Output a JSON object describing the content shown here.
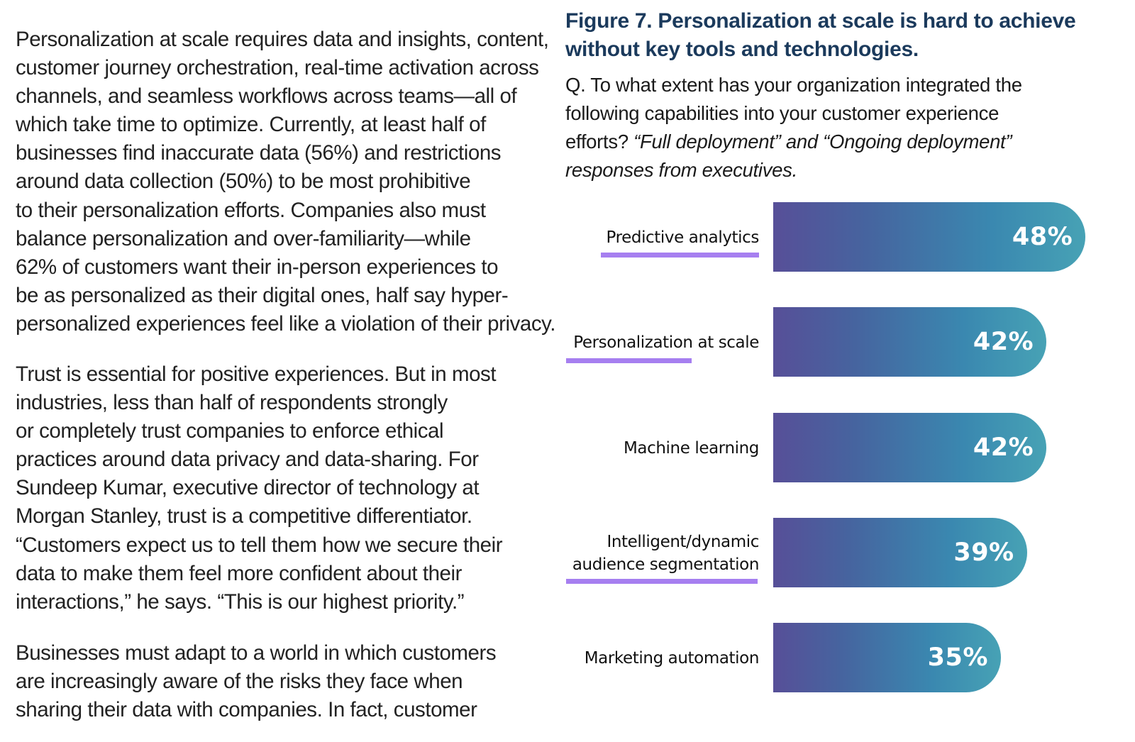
{
  "document": {
    "cut_off_top_line": "",
    "paragraphs": [
      {
        "lines": [
          "Personalization at scale requires data and insights, content,",
          "customer journey orchestration, real-time activation across",
          "channels, and seamless workflows across teams—all of",
          "which take time to optimize. Currently, at least half of",
          "businesses find inaccurate data (56%) and restrictions",
          "around data collection (50%) to be most prohibitive",
          "to their personalization efforts. Companies also must",
          "balance personalization and over-familiarity—while",
          "62% of customers want their in-person experiences to",
          "be as personalized as their digital ones, half say hyper-",
          "personalized experiences feel like a violation of their privacy."
        ]
      },
      {
        "lines": [
          "Trust is essential for positive experiences. But in most",
          "industries, less than half of respondents strongly",
          "or completely trust companies to enforce ethical",
          "practices around data privacy and data-sharing. For",
          "Sundeep Kumar, executive director of technology at",
          "Morgan Stanley, trust is a competitive differentiator.",
          "“Customers expect us to tell them how we secure their",
          "data to make them feel more confident about their",
          "interactions,” he says. “This is our highest priority.”"
        ]
      },
      {
        "lines": [
          "Businesses must adapt to a world in which customers",
          "are increasingly aware of the risks they face when",
          "sharing their data with companies. In fact, customer"
        ]
      }
    ]
  },
  "figure": {
    "title_lines": [
      "Figure 7. Personalization at scale is hard to achieve",
      "without key tools and technologies."
    ],
    "question": {
      "line1": "Q. To what extent has your organization integrated the",
      "line2": "following capabilities into your customer experience",
      "line3_plain": "efforts? ",
      "line3_italic": "“Full deployment” and “Ongoing deployment”",
      "line4_italic": "responses from executives."
    }
  },
  "colors": {
    "title": "#1b3a5c",
    "bar_gradient_start": "#574f98",
    "bar_gradient_end": "#47a2b5",
    "underline": "#a67ff0",
    "value_text": "#ffffff"
  },
  "chart_data": {
    "type": "bar",
    "orientation": "horizontal",
    "title": "Figure 7. Personalization at scale is hard to achieve without key tools and technologies.",
    "subtitle": "Q. To what extent has your organization integrated the following capabilities into your customer experience efforts? “Full deployment” and “Ongoing deployment” responses from executives.",
    "categories": [
      "Predictive analytics",
      "Personalization at scale",
      "Machine learning",
      "Intelligent/dynamic audience segmentation",
      "Marketing automation"
    ],
    "label_lines": [
      [
        "Predictive analytics"
      ],
      [
        "Personalization at scale"
      ],
      [
        "Machine learning"
      ],
      [
        "Intelligent/dynamic",
        "audience segmentation"
      ],
      [
        "Marketing automation"
      ]
    ],
    "highlighted": [
      true,
      true,
      false,
      true,
      false
    ],
    "values": [
      48,
      42,
      42,
      39,
      35
    ],
    "value_labels": [
      "48%",
      "42%",
      "42%",
      "39%",
      "35%"
    ],
    "unit": "%",
    "xlabel": "",
    "ylabel": "",
    "grid": false,
    "legend": "none"
  }
}
